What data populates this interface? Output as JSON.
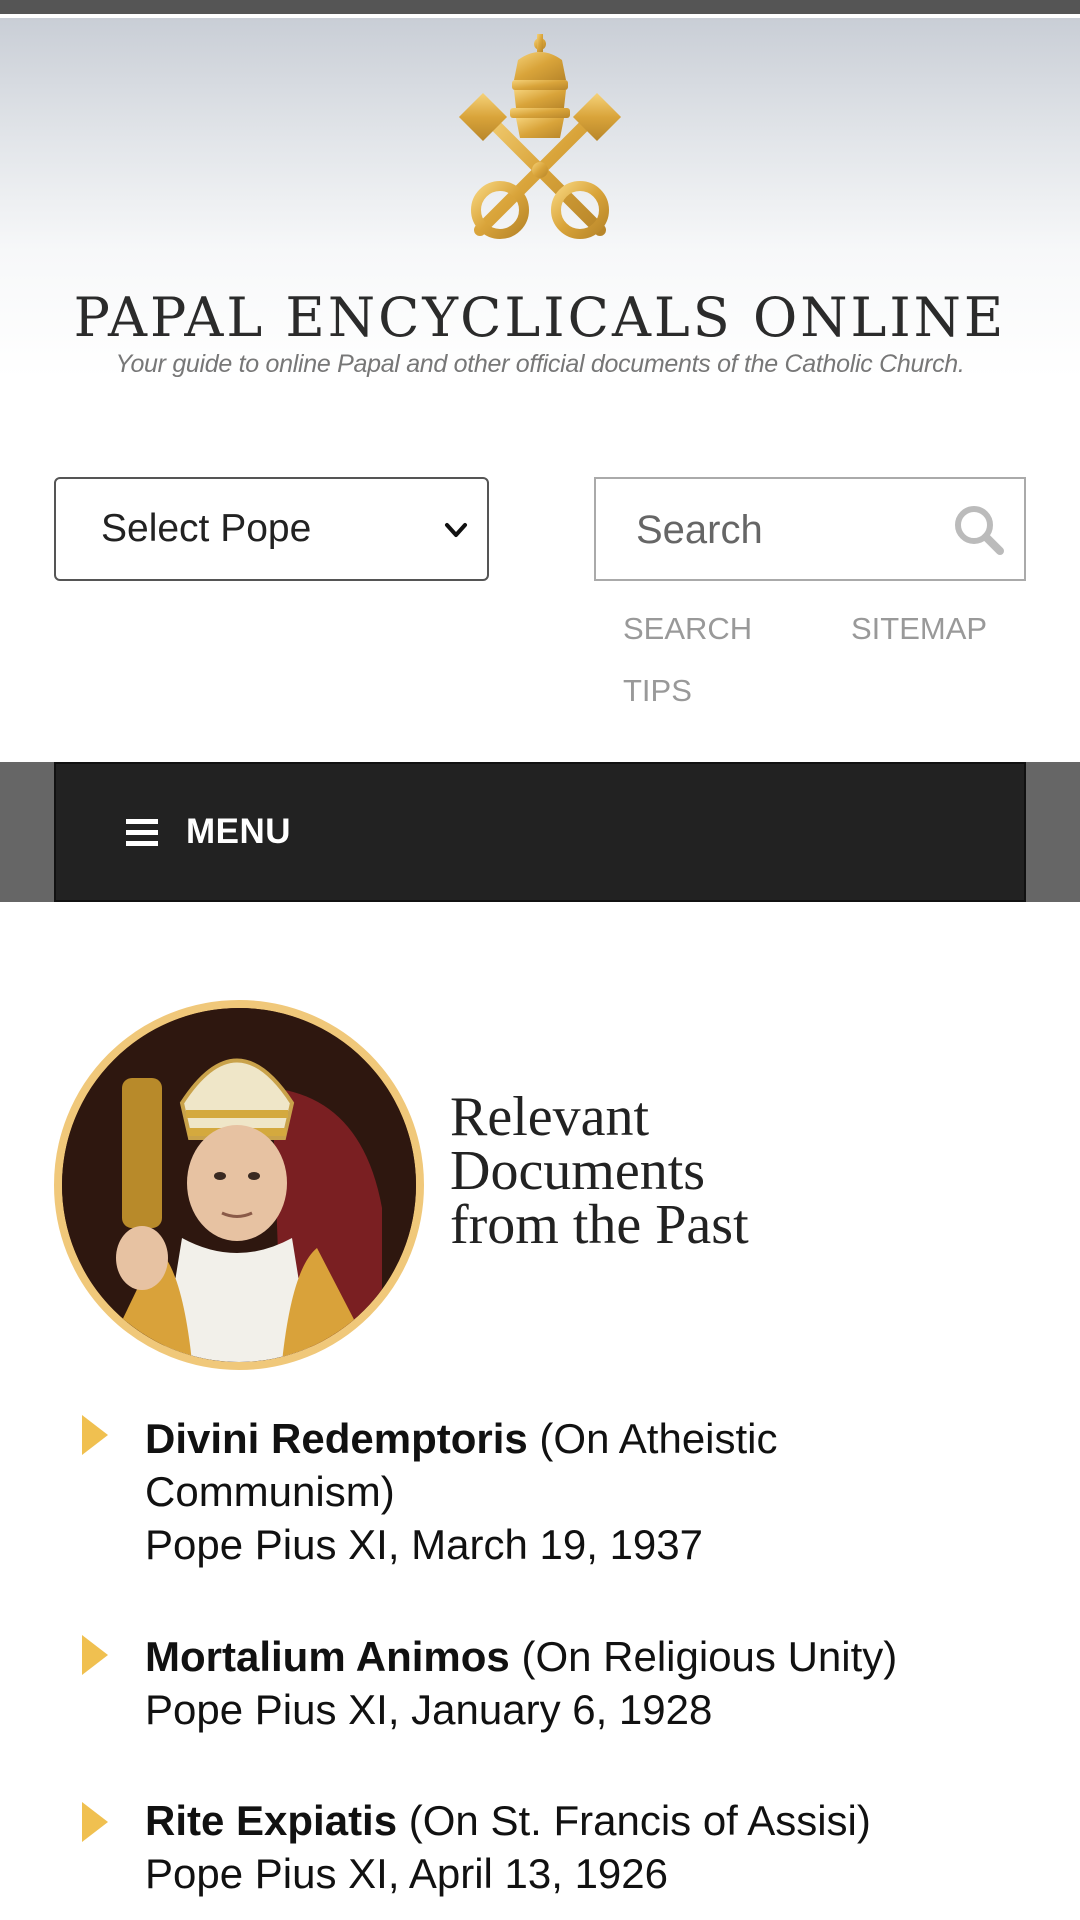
{
  "header": {
    "site_title": "PAPAL ENCYCLICALS ONLINE",
    "tagline": "Your guide to online Papal and other official documents of the Catholic Church."
  },
  "controls": {
    "select_pope_label": "Select Pope",
    "search_placeholder": "Search",
    "search_tips_label": "SEARCH TIPS",
    "sitemap_label": "SITEMAP"
  },
  "nav": {
    "menu_label": "MENU"
  },
  "featured": {
    "title_line1": "Relevant",
    "title_line2": "Documents",
    "title_line3": "from the Past"
  },
  "documents": [
    {
      "title": "Divini Redemptoris",
      "subtitle": "(On Atheistic Communism)",
      "meta": "Pope Pius XI, March 19, 1937"
    },
    {
      "title": "Mortalium Animos",
      "subtitle": "(On Religious Unity)",
      "meta": "Pope Pius XI, January 6, 1928"
    },
    {
      "title": "Rite Expiatis",
      "subtitle": "(On St. Francis of Assisi)",
      "meta": "Pope Pius XI, April 13, 1926"
    }
  ],
  "colors": {
    "gold": "#f0c050",
    "nav_dark": "#222222",
    "link_gray": "#999999"
  }
}
